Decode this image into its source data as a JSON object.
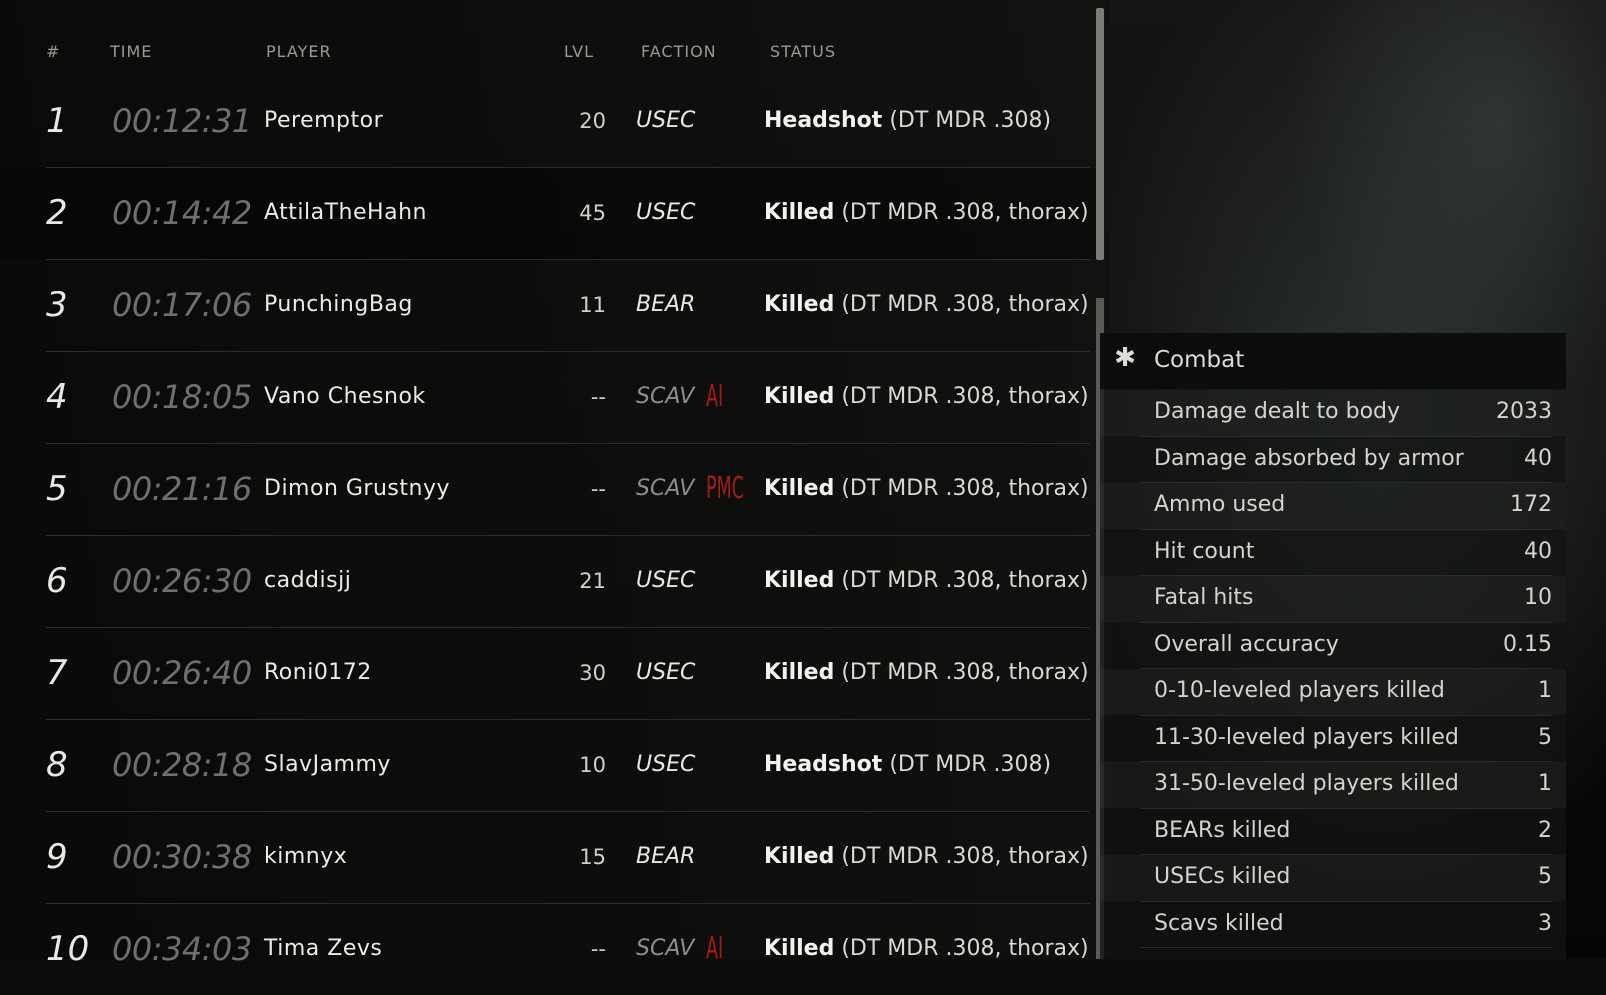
{
  "headers": {
    "num": "#",
    "time": "TIME",
    "player": "PLAYER",
    "lvl": "LVL",
    "faction": "FACTION",
    "status": "STATUS"
  },
  "kills": [
    {
      "num": "1",
      "time": "00:12:31",
      "player": "Peremptor",
      "lvl": "20",
      "faction": "USEC",
      "tag": "",
      "status_word": "Headshot",
      "status_detail": " (DT MDR .308)"
    },
    {
      "num": "2",
      "time": "00:14:42",
      "player": "AttilaTheHahn",
      "lvl": "45",
      "faction": "USEC",
      "tag": "",
      "status_word": "Killed",
      "status_detail": " (DT MDR .308, thorax)"
    },
    {
      "num": "3",
      "time": "00:17:06",
      "player": "PunchingBag",
      "lvl": "11",
      "faction": "BEAR",
      "tag": "",
      "status_word": "Killed",
      "status_detail": " (DT MDR .308, thorax)"
    },
    {
      "num": "4",
      "time": "00:18:05",
      "player": "Vano Chesnok",
      "lvl": "--",
      "faction": "SCAV",
      "tag": "AI",
      "status_word": "Killed",
      "status_detail": " (DT MDR .308, thorax)"
    },
    {
      "num": "5",
      "time": "00:21:16",
      "player": "Dimon Grustnyy",
      "lvl": "--",
      "faction": "SCAV",
      "tag": "PMC",
      "status_word": "Killed",
      "status_detail": " (DT MDR .308, thorax)"
    },
    {
      "num": "6",
      "time": "00:26:30",
      "player": "caddisjj",
      "lvl": "21",
      "faction": "USEC",
      "tag": "",
      "status_word": "Killed",
      "status_detail": " (DT MDR .308, thorax)"
    },
    {
      "num": "7",
      "time": "00:26:40",
      "player": "Roni0172",
      "lvl": "30",
      "faction": "USEC",
      "tag": "",
      "status_word": "Killed",
      "status_detail": " (DT MDR .308, thorax)"
    },
    {
      "num": "8",
      "time": "00:28:18",
      "player": "SlavJammy",
      "lvl": "10",
      "faction": "USEC",
      "tag": "",
      "status_word": "Headshot",
      "status_detail": " (DT MDR .308)"
    },
    {
      "num": "9",
      "time": "00:30:38",
      "player": "kimnyx",
      "lvl": "15",
      "faction": "BEAR",
      "tag": "",
      "status_word": "Killed",
      "status_detail": " (DT MDR .308, thorax)"
    },
    {
      "num": "10",
      "time": "00:34:03",
      "player": "Tima Zevs",
      "lvl": "--",
      "faction": "SCAV",
      "tag": "AI",
      "status_word": "Killed",
      "status_detail": " (DT MDR .308, thorax)"
    }
  ],
  "combat": {
    "title": "Combat",
    "icon": "gear-icon",
    "stats": [
      {
        "label": "Damage dealt to body",
        "value": "2033"
      },
      {
        "label": "Damage absorbed by armor",
        "value": "40"
      },
      {
        "label": "Ammo used",
        "value": "172"
      },
      {
        "label": "Hit count",
        "value": "40"
      },
      {
        "label": "Fatal hits",
        "value": "10"
      },
      {
        "label": "Overall accuracy",
        "value": "0.15"
      },
      {
        "label": "0-10-leveled players killed",
        "value": "1"
      },
      {
        "label": "11-30-leveled players killed",
        "value": "5"
      },
      {
        "label": "31-50-leveled players killed",
        "value": "1"
      },
      {
        "label": "BEARs killed",
        "value": "2"
      },
      {
        "label": "USECs killed",
        "value": "5"
      },
      {
        "label": "Scavs killed",
        "value": "3"
      }
    ]
  },
  "colors": {
    "tag_red": "#a31d1d",
    "time_grey": "#6f706c"
  }
}
